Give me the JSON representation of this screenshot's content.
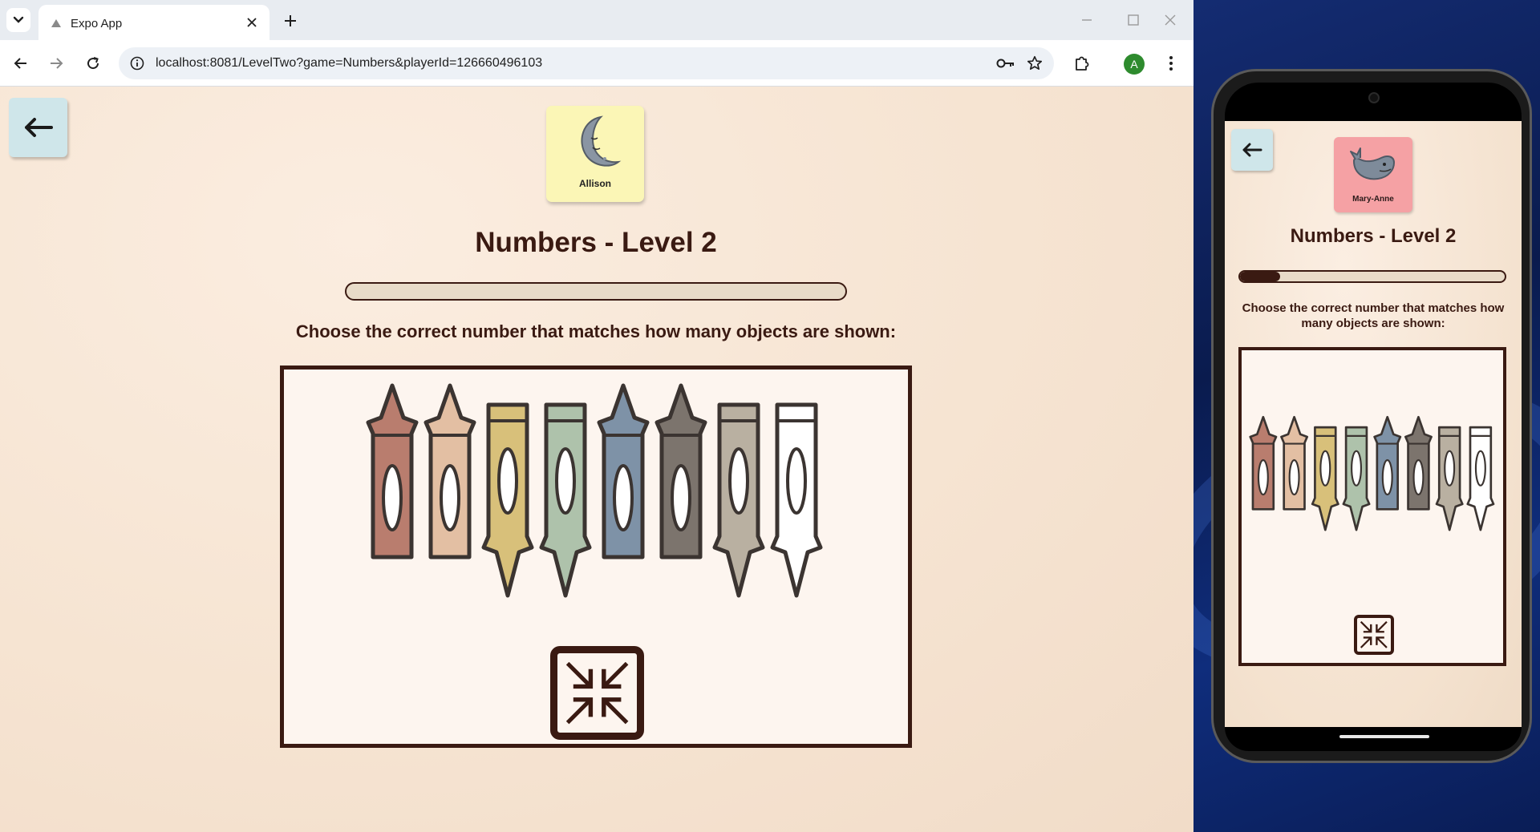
{
  "browser": {
    "tab_title": "Expo App",
    "url": "localhost:8081/LevelTwo?game=Numbers&playerId=126660496103",
    "profile_initial": "A"
  },
  "icons": {
    "back": "arrow-left-icon",
    "collapse": "collapse-arrows-icon",
    "browser_back": "browser-back-icon",
    "forward": "forward-icon",
    "reload": "reload-icon",
    "site_info": "site-info-icon",
    "password": "key-icon",
    "bookmark": "star-icon",
    "extensions": "puzzle-piece-icon",
    "menu": "kebab-menu-icon"
  },
  "desktop_app": {
    "player": {
      "name": "Allison",
      "avatar": "moon-avatar",
      "card_color": "#fbf6b6"
    },
    "title": "Numbers - Level 2",
    "progress": 0.0,
    "instruction": "Choose the correct number that matches how many objects are shown:",
    "object_count": 8
  },
  "phone_app": {
    "player": {
      "name": "Mary-Anne",
      "avatar": "whale-avatar",
      "card_color": "#f5a1a4"
    },
    "title": "Numbers - Level 2",
    "progress": 0.15,
    "instruction": "Choose the correct number that matches how many objects are shown:",
    "object_count": 8
  },
  "crayon_colors": [
    "#b97d6e",
    "#e3bfa3",
    "#d8c07a",
    "#aec2ab",
    "#7e92a7",
    "#7c746d",
    "#b9b0a1",
    "#ffffff"
  ],
  "theme": {
    "dark_brown": "#3a1a12",
    "back_button": "#cfe6ea"
  }
}
